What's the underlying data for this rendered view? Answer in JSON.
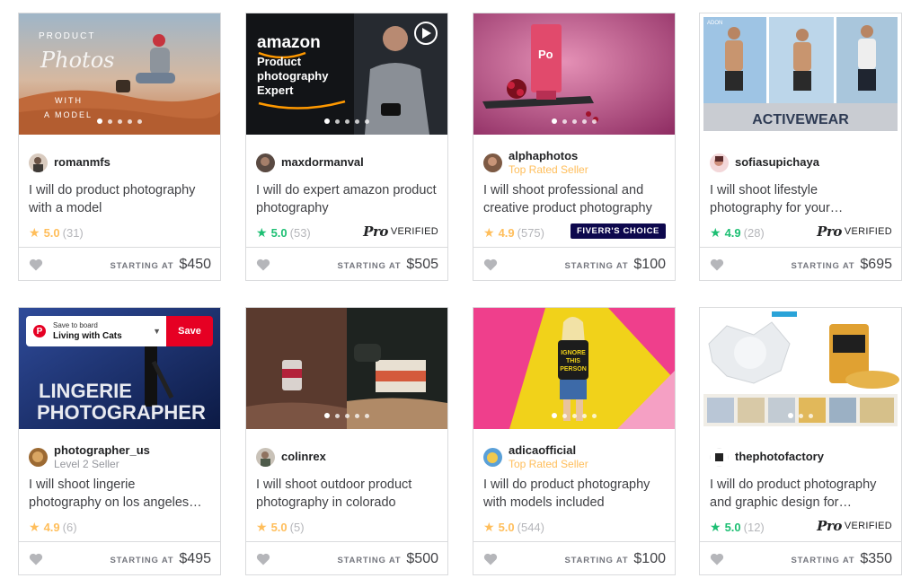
{
  "labels": {
    "starting_at": "STARTING AT",
    "pro": "Pro",
    "verified": "VERIFIED",
    "fivers_choice": "FIVERR'S CHOICE"
  },
  "save_widget": {
    "small": "Save to board",
    "board": "Living with Cats",
    "button": "Save"
  },
  "thumb_text": {
    "g1": {
      "line1": "PRODUCT",
      "line2": "Photos",
      "line3": "WITH",
      "line4": "A MODEL"
    },
    "g2": {
      "line1": "amazon",
      "line2": "Product",
      "line3": "photography",
      "line4": "Expert"
    },
    "g3": {
      "label": "Po"
    },
    "g4": {
      "banner": "ACTIVEWEAR",
      "brand": "ADON"
    },
    "g5": {
      "line1": "LINGERIE",
      "line2": "PHOTOGRAPHER"
    },
    "g7": {
      "line1": "IGNORE",
      "line2": "THIS",
      "line3": "PERSON"
    }
  },
  "gigs": [
    {
      "seller": "romanmfs",
      "level": "",
      "title": "I will do product photography with a model",
      "score": "5.0",
      "count": "(31)",
      "star_color": "gold",
      "badge": "",
      "price": "$450"
    },
    {
      "seller": "maxdormanval",
      "level": "",
      "title": "I will do expert amazon product photography",
      "score": "5.0",
      "count": "(53)",
      "star_color": "green",
      "badge": "pro",
      "price": "$505"
    },
    {
      "seller": "alphaphotos",
      "level": "Top Rated Seller",
      "title": "I will shoot professional and creative product photography",
      "score": "4.9",
      "count": "(575)",
      "star_color": "gold",
      "badge": "choice",
      "price": "$100"
    },
    {
      "seller": "sofiasupichaya",
      "level": "",
      "title": "I will shoot lifestyle photography for your…",
      "score": "4.9",
      "count": "(28)",
      "star_color": "green",
      "badge": "pro",
      "price": "$695"
    },
    {
      "seller": "photographer_us",
      "level": "Level 2 Seller",
      "title": "I will shoot lingerie photography on los angeles…",
      "score": "4.9",
      "count": "(6)",
      "star_color": "gold",
      "badge": "",
      "price": "$495"
    },
    {
      "seller": "colinrex",
      "level": "",
      "title": "I will shoot outdoor product photography in colorado",
      "score": "5.0",
      "count": "(5)",
      "star_color": "gold",
      "badge": "",
      "price": "$500"
    },
    {
      "seller": "adicaofficial",
      "level": "Top Rated Seller",
      "title": "I will do product photography with models included",
      "score": "5.0",
      "count": "(544)",
      "star_color": "gold",
      "badge": "",
      "price": "$100"
    },
    {
      "seller": "thephotofactory",
      "level": "",
      "title": "I will do product photography and graphic design for…",
      "score": "5.0",
      "count": "(12)",
      "star_color": "green",
      "badge": "pro",
      "price": "$350"
    }
  ],
  "colors": {
    "gold": "#ffbe5b",
    "green": "#1dbf73",
    "choice_bg": "#0d084d",
    "pinterest_red": "#e60023"
  }
}
